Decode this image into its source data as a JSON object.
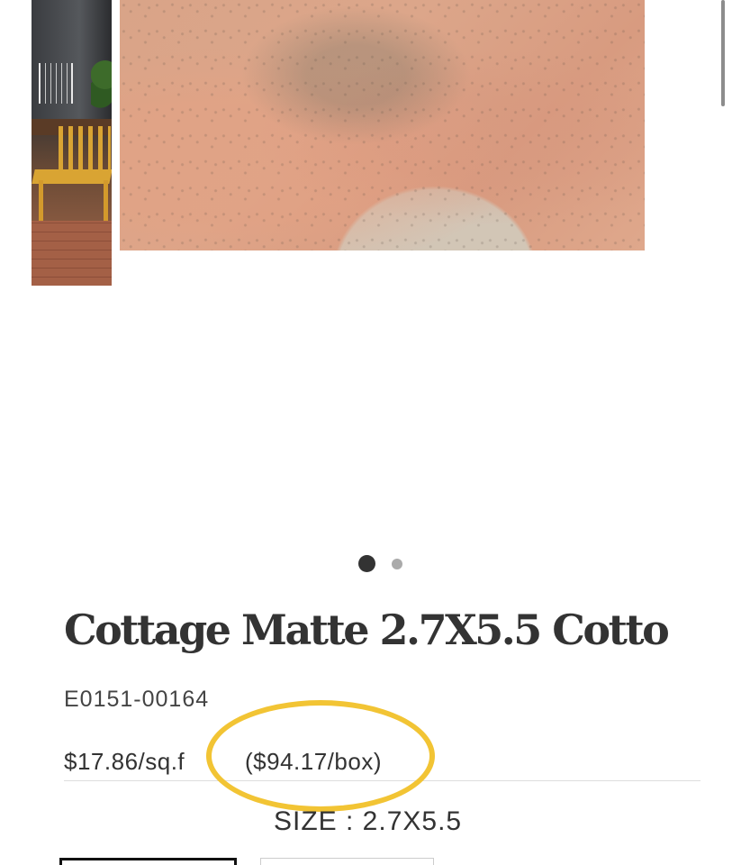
{
  "product": {
    "title": "Cottage Matte 2.7X5.5 Cotto",
    "sku": "E0151-00164",
    "price_per_sqft": "$17.86/sq.f",
    "price_per_box": "($94.17/box)",
    "size_label": "SIZE : 2.7X5.5"
  },
  "gallery": {
    "slide_count": 2,
    "active_slide": 1
  },
  "colors": {
    "highlight": "#f2c434",
    "text": "#333333",
    "dot_active": "#333333",
    "dot_inactive": "#aaaaaa"
  }
}
